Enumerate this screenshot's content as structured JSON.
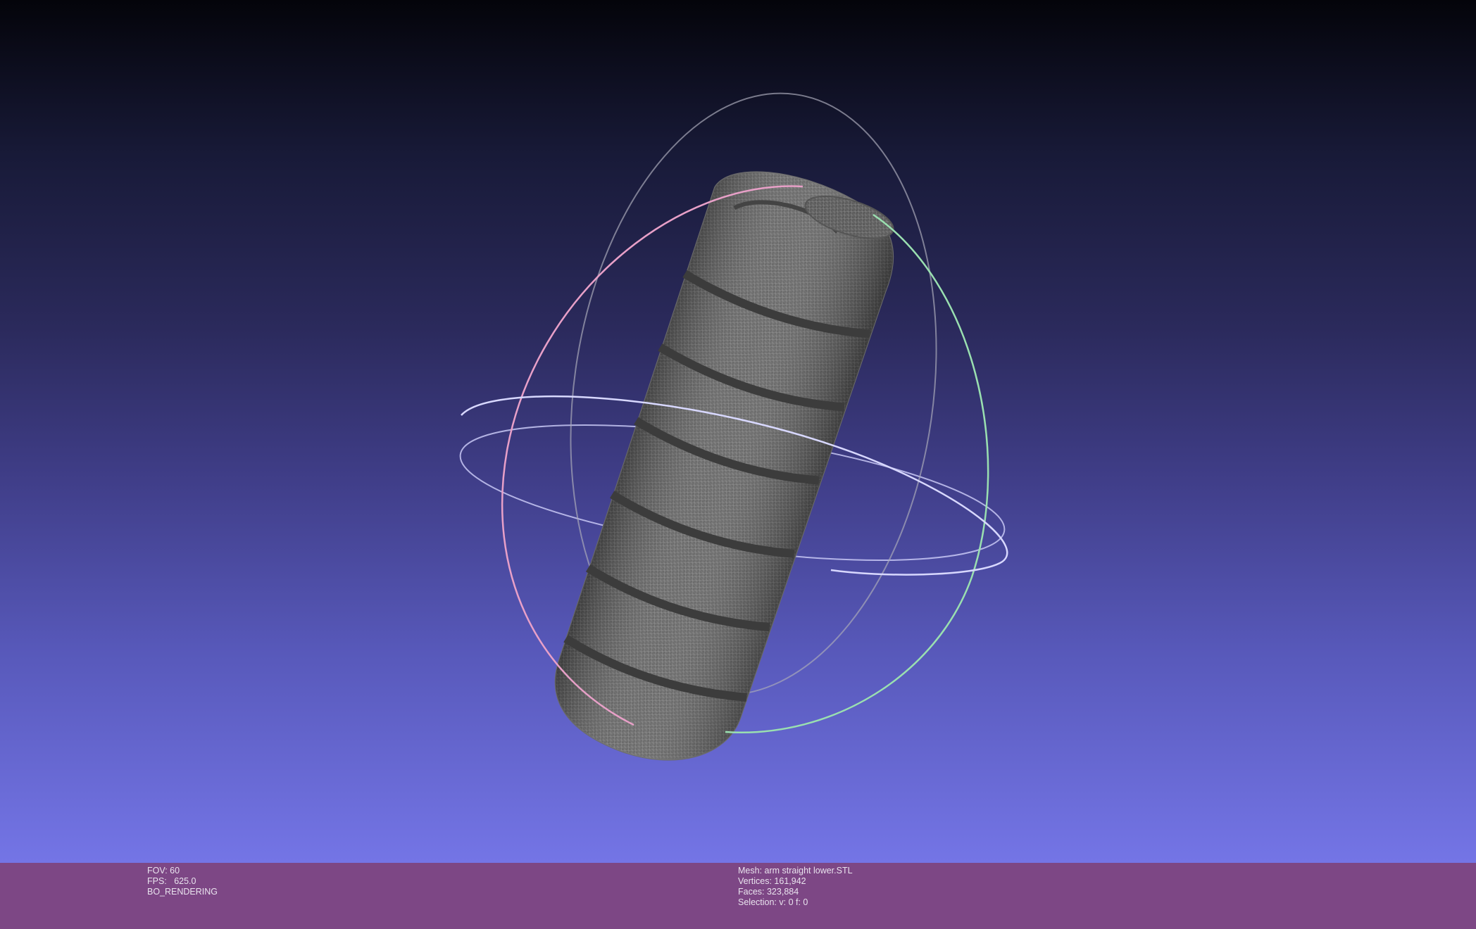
{
  "colors": {
    "background_top": "#04040a",
    "background_bottom": "#7475e6",
    "info_bar": "#7d4785",
    "mesh": "#8f8f8f",
    "trackball_x": "#e8a0c8",
    "trackball_y": "#9ae0b0",
    "trackball_z": "#b8b8f0"
  },
  "info_left": {
    "fov": "FOV: 60",
    "fps": "FPS:   625.0",
    "render_mode": "BO_RENDERING"
  },
  "info_right": {
    "mesh": "Mesh: arm straight lower.STL",
    "vertices": "Vertices: 161,942",
    "faces": "Faces: 323,884",
    "selection": "Selection: v: 0 f: 0"
  }
}
